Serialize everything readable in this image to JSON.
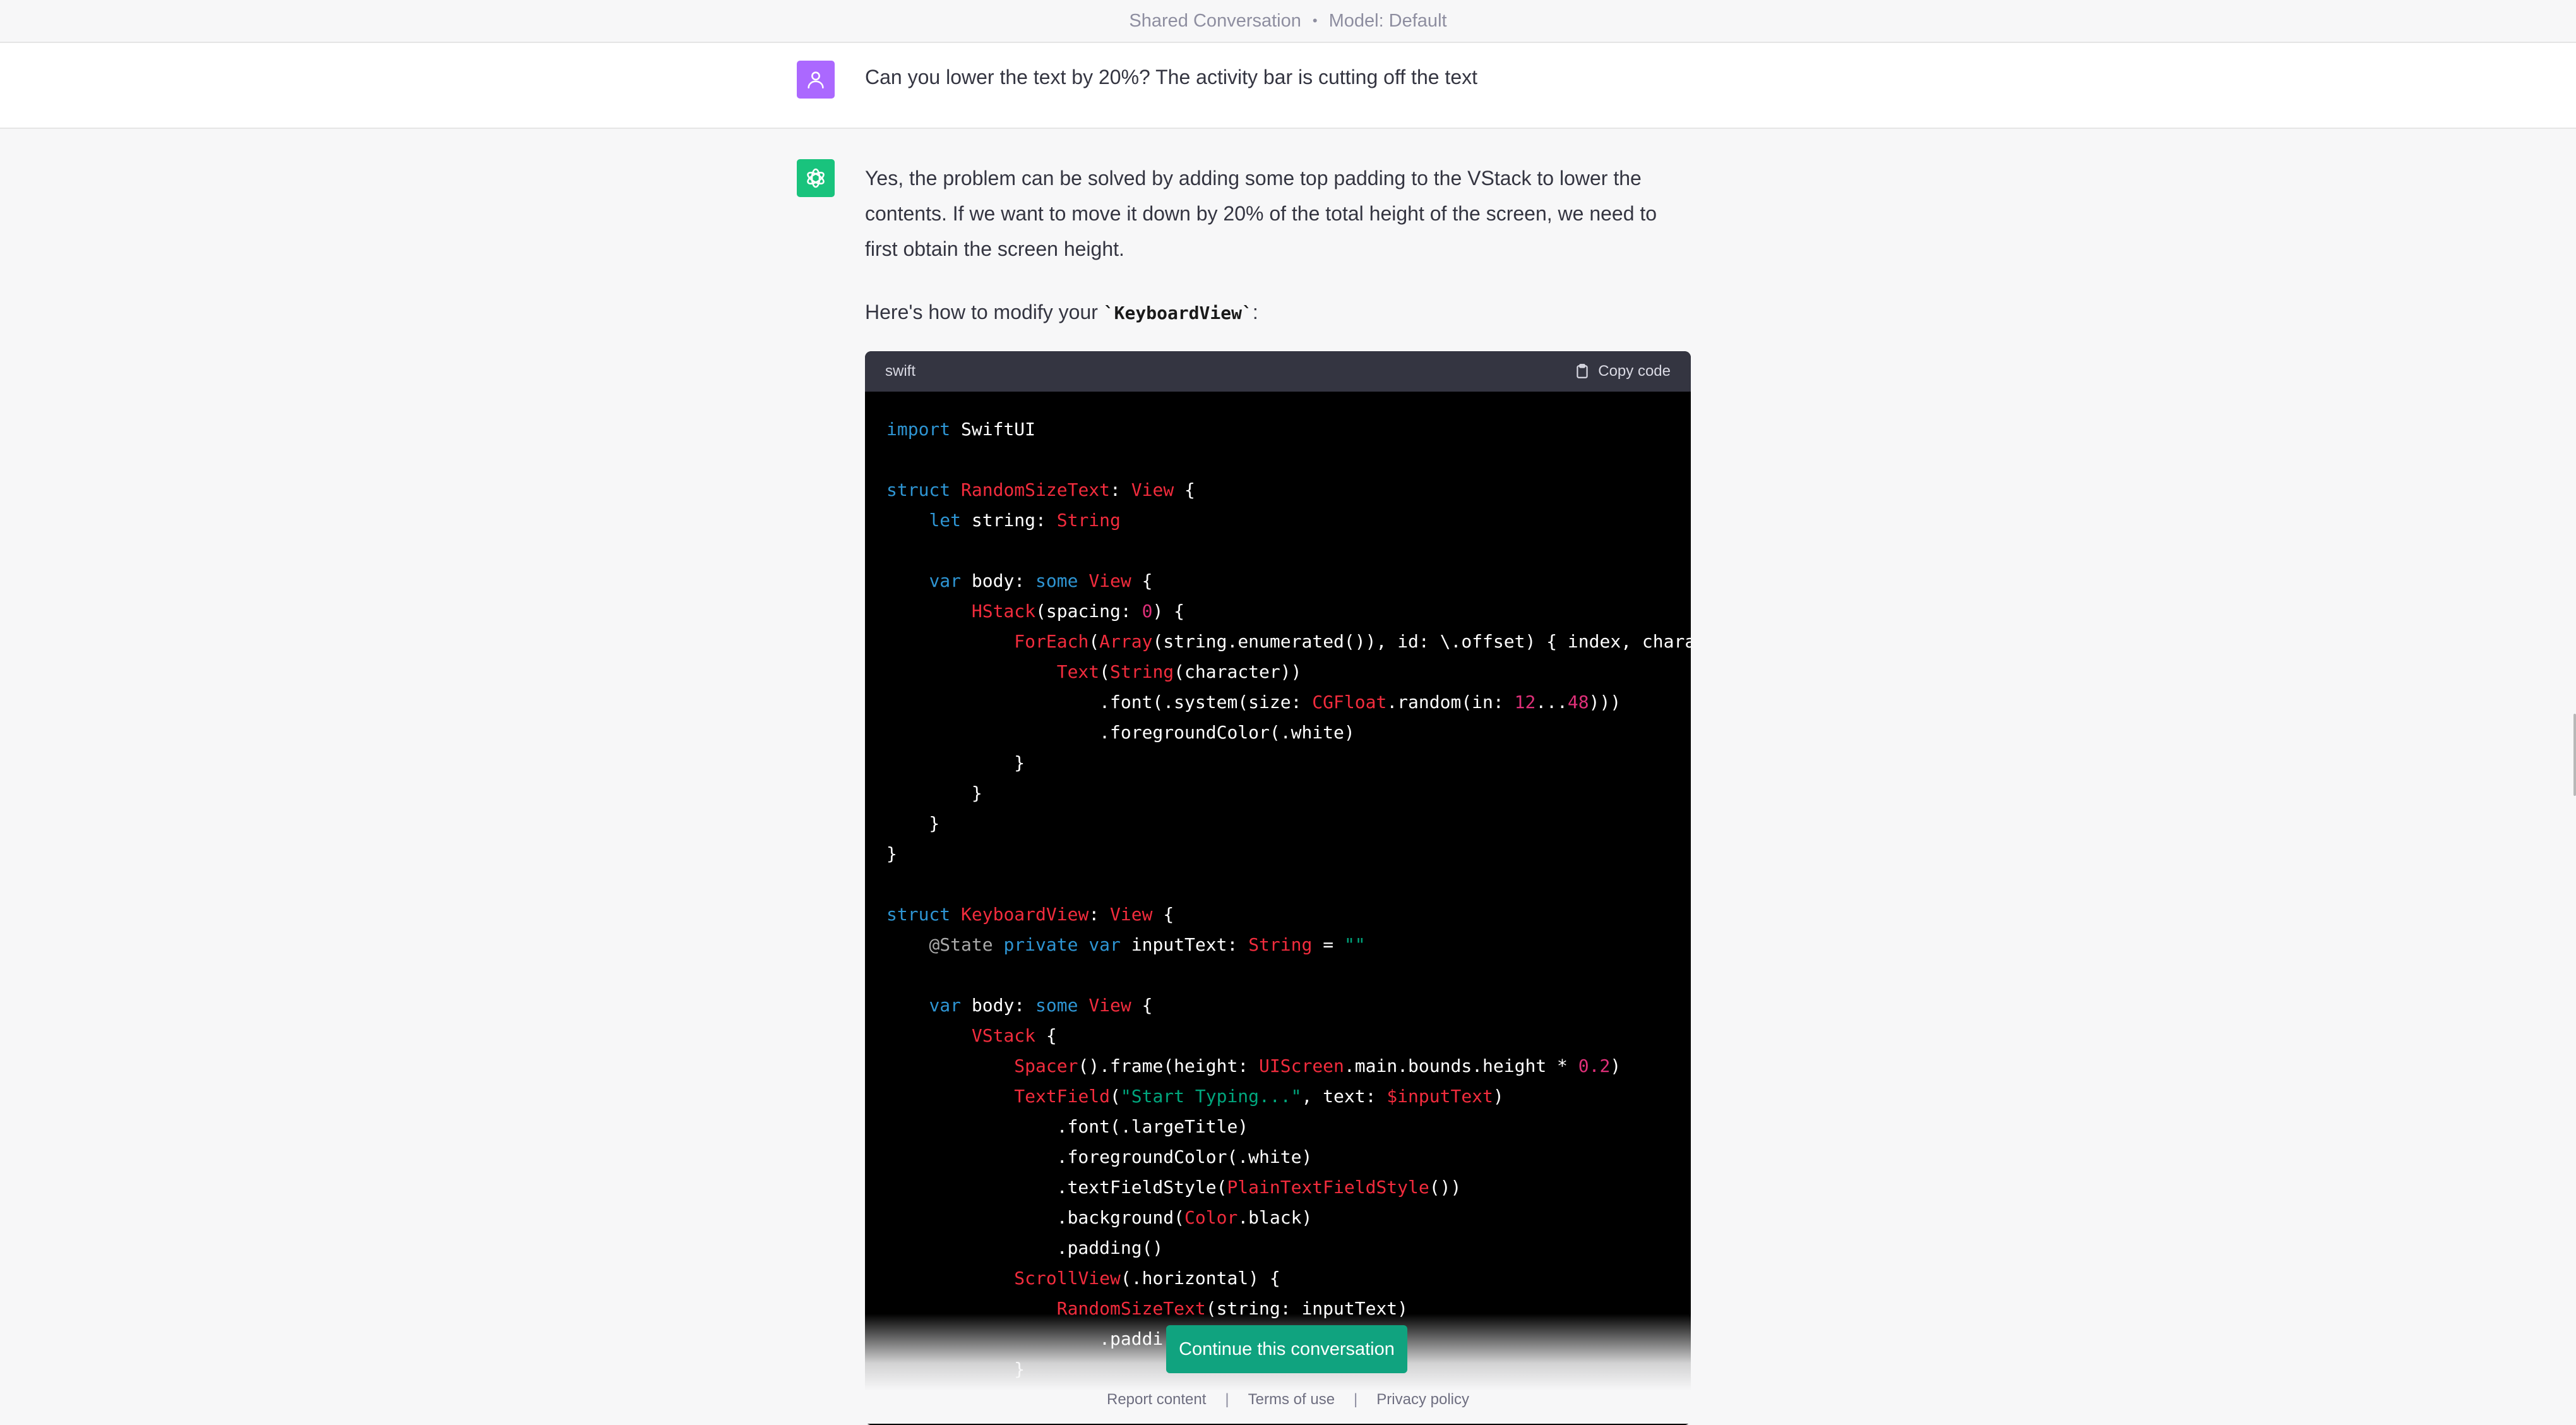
{
  "header": {
    "left": "Shared Conversation",
    "separator": "•",
    "right": "Model: Default"
  },
  "user_message": {
    "text": "Can you lower the text by 20%? The activity bar is cutting off the text"
  },
  "assistant_message": {
    "paragraph1": "Yes, the problem can be solved by adding some top padding to the VStack to lower the contents. If we want to move it down by 20% of the total height of the screen, we need to first obtain the screen height.",
    "paragraph2_prefix": "Here's how to modify your ",
    "paragraph2_code": "`KeyboardView`",
    "paragraph2_suffix": ":"
  },
  "code_block": {
    "language": "swift",
    "copy_label": "Copy code",
    "colors": {
      "keyword": "#2e95d3",
      "type": "#f22c3d",
      "string": "#00a67d",
      "number": "#df3079",
      "plain": "#ffffff",
      "comment": "#aaaaaa"
    },
    "lines": [
      [
        [
          "k",
          "import"
        ],
        [
          "p",
          " SwiftUI"
        ]
      ],
      [],
      [
        [
          "k",
          "struct"
        ],
        [
          "p",
          " "
        ],
        [
          "t",
          "RandomSizeText"
        ],
        [
          "p",
          ": "
        ],
        [
          "t",
          "View"
        ],
        [
          "p",
          " {"
        ]
      ],
      [
        [
          "p",
          "    "
        ],
        [
          "k",
          "let"
        ],
        [
          "p",
          " string: "
        ],
        [
          "t",
          "String"
        ]
      ],
      [],
      [
        [
          "p",
          "    "
        ],
        [
          "k",
          "var"
        ],
        [
          "p",
          " body: "
        ],
        [
          "k",
          "some"
        ],
        [
          "p",
          " "
        ],
        [
          "t",
          "View"
        ],
        [
          "p",
          " {"
        ]
      ],
      [
        [
          "p",
          "        "
        ],
        [
          "t",
          "HStack"
        ],
        [
          "p",
          "(spacing: "
        ],
        [
          "n",
          "0"
        ],
        [
          "p",
          ") {"
        ]
      ],
      [
        [
          "p",
          "            "
        ],
        [
          "t",
          "ForEach"
        ],
        [
          "p",
          "("
        ],
        [
          "t",
          "Array"
        ],
        [
          "p",
          "(string.enumerated()), id: \\.offset) { index, chara"
        ]
      ],
      [
        [
          "p",
          "                "
        ],
        [
          "t",
          "Text"
        ],
        [
          "p",
          "("
        ],
        [
          "t",
          "String"
        ],
        [
          "p",
          "(character))"
        ]
      ],
      [
        [
          "p",
          "                    .font(.system(size: "
        ],
        [
          "t",
          "CGFloat"
        ],
        [
          "p",
          ".random(in: "
        ],
        [
          "n",
          "12"
        ],
        [
          "p",
          "..."
        ],
        [
          "n",
          "48"
        ],
        [
          "p",
          ")))"
        ]
      ],
      [
        [
          "p",
          "                    .foregroundColor(.white)"
        ]
      ],
      [
        [
          "p",
          "            }"
        ]
      ],
      [
        [
          "p",
          "        }"
        ]
      ],
      [
        [
          "p",
          "    }"
        ]
      ],
      [
        [
          "p",
          "}"
        ]
      ],
      [],
      [
        [
          "k",
          "struct"
        ],
        [
          "p",
          " "
        ],
        [
          "t",
          "KeyboardView"
        ],
        [
          "p",
          ": "
        ],
        [
          "t",
          "View"
        ],
        [
          "p",
          " {"
        ]
      ],
      [
        [
          "p",
          "    "
        ],
        [
          "c",
          "@State"
        ],
        [
          "p",
          " "
        ],
        [
          "k",
          "private"
        ],
        [
          "p",
          " "
        ],
        [
          "k",
          "var"
        ],
        [
          "p",
          " inputText: "
        ],
        [
          "t",
          "String"
        ],
        [
          "p",
          " = "
        ],
        [
          "s",
          "\"\""
        ]
      ],
      [],
      [
        [
          "p",
          "    "
        ],
        [
          "k",
          "var"
        ],
        [
          "p",
          " body: "
        ],
        [
          "k",
          "some"
        ],
        [
          "p",
          " "
        ],
        [
          "t",
          "View"
        ],
        [
          "p",
          " {"
        ]
      ],
      [
        [
          "p",
          "        "
        ],
        [
          "t",
          "VStack"
        ],
        [
          "p",
          " {"
        ]
      ],
      [
        [
          "p",
          "            "
        ],
        [
          "t",
          "Spacer"
        ],
        [
          "p",
          "().frame(height: "
        ],
        [
          "t",
          "UIScreen"
        ],
        [
          "p",
          ".main.bounds.height * "
        ],
        [
          "n",
          "0.2"
        ],
        [
          "p",
          ")"
        ]
      ],
      [
        [
          "p",
          "            "
        ],
        [
          "t",
          "TextField"
        ],
        [
          "p",
          "("
        ],
        [
          "s",
          "\"Start Typing...\""
        ],
        [
          "p",
          ", text: "
        ],
        [
          "t",
          "$inputText"
        ],
        [
          "p",
          ")"
        ]
      ],
      [
        [
          "p",
          "                .font(.largeTitle)"
        ]
      ],
      [
        [
          "p",
          "                .foregroundColor(.white)"
        ]
      ],
      [
        [
          "p",
          "                .textFieldStyle("
        ],
        [
          "t",
          "PlainTextFieldStyle"
        ],
        [
          "p",
          "())"
        ]
      ],
      [
        [
          "p",
          "                .background("
        ],
        [
          "t",
          "Color"
        ],
        [
          "p",
          ".black)"
        ]
      ],
      [
        [
          "p",
          "                .padding()"
        ]
      ],
      [
        [
          "p",
          "            "
        ],
        [
          "t",
          "ScrollView"
        ],
        [
          "p",
          "(.horizontal) {"
        ]
      ],
      [
        [
          "p",
          "                "
        ],
        [
          "t",
          "RandomSizeText"
        ],
        [
          "p",
          "(string: inputText)"
        ]
      ],
      [
        [
          "p",
          "                    .paddi"
        ]
      ],
      [
        [
          "p",
          "            }"
        ]
      ]
    ]
  },
  "continue_button": "Continue this conversation",
  "footer": {
    "links": [
      "Report content",
      "Terms of use",
      "Privacy policy"
    ],
    "separator": "|"
  }
}
